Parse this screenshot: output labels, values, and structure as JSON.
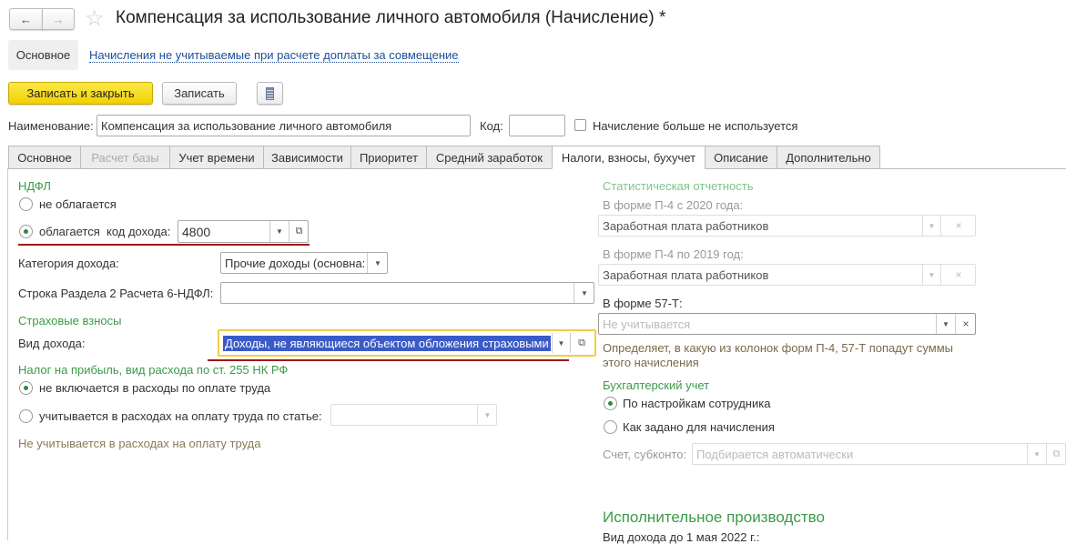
{
  "window": {
    "title": "Компенсация за использование личного автомобиля (Начисление) *"
  },
  "nav": {
    "back": "←",
    "forward": "→"
  },
  "top_tabs": {
    "main": "Основное",
    "link": "Начисления не учитываемые при расчете доплаты за совмещение"
  },
  "toolbar": {
    "save_close": "Записать и закрыть",
    "save": "Записать"
  },
  "header": {
    "name_label": "Наименование:",
    "name_value": "Компенсация за использование личного автомобиля",
    "code_label": "Код:",
    "code_value": "",
    "unused_label": "Начисление больше не используется"
  },
  "tabs": [
    "Основное",
    "Расчет базы",
    "Учет времени",
    "Зависимости",
    "Приоритет",
    "Средний заработок",
    "Налоги, взносы, бухучет",
    "Описание",
    "Дополнительно"
  ],
  "ndfl": {
    "title": "НДФЛ",
    "not_taxed": "не облагается",
    "taxed": "облагается",
    "code_label": "код дохода:",
    "code_value": "4800",
    "category_label": "Категория дохода:",
    "category_value": "Прочие доходы (основна:",
    "row_label": "Строка Раздела 2 Расчета 6-НДФЛ:",
    "row_value": ""
  },
  "insurance": {
    "title": "Страховые взносы",
    "kind_label": "Вид дохода:",
    "kind_value": "Доходы, не являющиеся объектом обложения страховыми"
  },
  "profit": {
    "title": "Налог на прибыль, вид расхода по ст. 255 НК РФ",
    "opt1": "не включается в расходы по оплате труда",
    "opt2": "учитывается в расходах на оплату труда по статье:",
    "note": "Не учитывается в расходах на оплату труда"
  },
  "stats": {
    "title": "Статистическая отчетность",
    "p4_2020_label": "В форме П-4 с 2020 года:",
    "p4_2020_value": "Заработная плата работников",
    "p4_2019_label": "В форме П-4 по 2019 год:",
    "p4_2019_value": "Заработная плата работников",
    "f57_label": "В форме 57-Т:",
    "f57_placeholder": "Не учитывается",
    "hint1": "Определяет, в какую из колонок форм П-4, 57-Т попадут суммы",
    "hint2": "этого начисления"
  },
  "accounting": {
    "title": "Бухгалтерский учет",
    "opt1": "По настройкам сотрудника",
    "opt2": "Как задано для начисления",
    "account_label": "Счет, субконто:",
    "account_placeholder": "Подбирается автоматически"
  },
  "enforcement": {
    "title": "Исполнительное производство",
    "kind_label": "Вид дохода до 1 мая 2022 г.:"
  }
}
